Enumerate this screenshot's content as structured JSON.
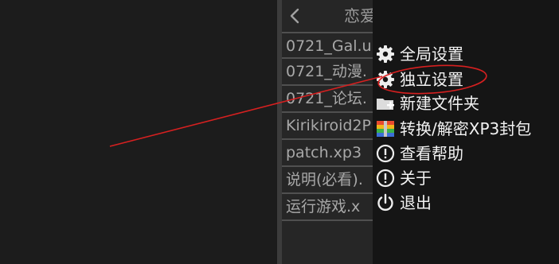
{
  "header": {
    "title": "恋爱"
  },
  "file_list": [
    "0721_Gal.u",
    "0721_动漫.",
    "0721_论坛.",
    "Kirikiroid2P",
    "patch.xp3",
    "说明(必看).",
    "运行游戏.x"
  ],
  "menu": {
    "items": [
      {
        "label": "全局设置",
        "icon": "gear-icon"
      },
      {
        "label": "独立设置",
        "icon": "gear-icon"
      },
      {
        "label": "新建文件夹",
        "icon": "folder-plus-icon"
      },
      {
        "label": "转换/解密XP3封包",
        "icon": "archive-icon"
      },
      {
        "label": "查看帮助",
        "icon": "info-icon"
      },
      {
        "label": "关于",
        "icon": "info-icon"
      },
      {
        "label": "退出",
        "icon": "power-icon"
      }
    ]
  },
  "annotation": {
    "color": "#d62020"
  }
}
